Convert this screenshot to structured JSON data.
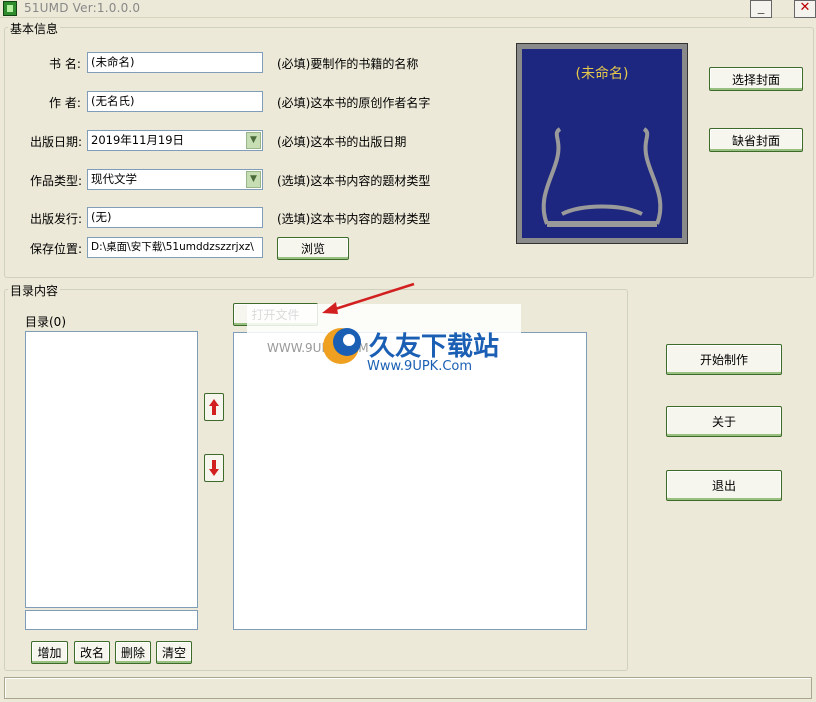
{
  "window": {
    "title": "51UMD Ver:1.0.0.0"
  },
  "basic": {
    "legend": "基本信息",
    "book_name": {
      "label": "书  名:",
      "value": "(未命名)",
      "hint": "(必填)要制作的书籍的名称"
    },
    "author": {
      "label": "作  者:",
      "value": "(无名氏)",
      "hint": "(必填)这本书的原创作者名字"
    },
    "publish_date": {
      "label": "出版日期:",
      "value": "2019年11月19日",
      "hint": "(必填)这本书的出版日期"
    },
    "genre": {
      "label": "作品类型:",
      "value": "现代文学",
      "hint": "(选填)这本书内容的题材类型"
    },
    "publisher": {
      "label": "出版发行:",
      "value": "(无)",
      "hint": "(选填)这本书内容的题材类型"
    },
    "save_location": {
      "label": "保存位置:",
      "value": "D:\\桌面\\安下载\\51umddzszzrjxz\\",
      "browse_label": "浏览"
    },
    "cover_title": "(未命名)",
    "select_cover_label": "选择封面",
    "default_cover_label": "缺省封面"
  },
  "toc": {
    "legend": "目录内容",
    "list_label": "目录(0)",
    "open_file_label": "打开文件",
    "add_label": "增加",
    "rename_label": "改名",
    "delete_label": "删除",
    "clear_label": "清空"
  },
  "actions": {
    "start_label": "开始制作",
    "about_label": "关于",
    "exit_label": "退出"
  },
  "watermark": {
    "brand": "久友下载站",
    "url": "Www.9UPK.Com",
    "url_left": "WWW.9UPK.COM"
  },
  "colors": {
    "accent": "#3d6b2a",
    "cover_bg": "#1d2780",
    "arrow_red": "#d22020"
  }
}
